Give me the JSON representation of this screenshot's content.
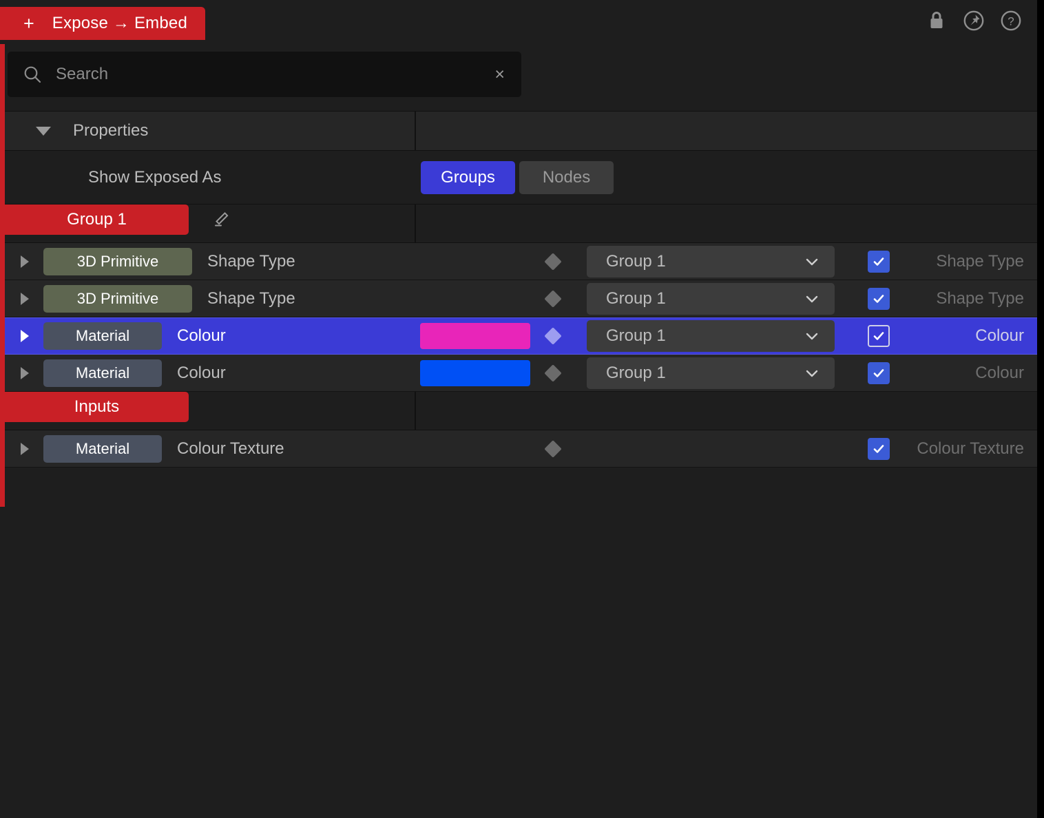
{
  "topbar": {
    "expose_tab": {
      "plus": "+",
      "label": "Expose → Embed"
    },
    "icons": [
      {
        "name": "lock-icon",
        "title": "Lock"
      },
      {
        "name": "pin-icon",
        "title": "Pin"
      },
      {
        "name": "help-icon",
        "title": "Help"
      }
    ]
  },
  "search": {
    "placeholder": "Search",
    "value": "",
    "clear_label": "×"
  },
  "sections": {
    "properties": {
      "title": "Properties",
      "expanded": true,
      "show_exposed_as": {
        "label": "Show Exposed As",
        "options": [
          "Groups",
          "Nodes"
        ],
        "selected": "Groups"
      }
    },
    "group1": {
      "tab_label": "Group 1",
      "edit_icon": "pencil-icon"
    },
    "inputs": {
      "tab_label": "Inputs"
    }
  },
  "colors": {
    "accent_red": "#c92026",
    "accent_blue": "#3b3bd6",
    "chip_primitive": "#5e6650",
    "chip_material": "#4a5160",
    "swatch_magenta": "#e825b9",
    "swatch_blue": "#0050f5",
    "checkbox_blue": "#3b5bd6",
    "panel_bg": "#1e1e1e",
    "row_bg": "#262626"
  },
  "group_rows": [
    {
      "node_type": "3D Primitive",
      "chip_style": "primitive",
      "property": "Shape Type",
      "swatch": null,
      "keyframe": true,
      "group": "Group 1",
      "checked": true,
      "exposed_name": "Shape Type",
      "selected": false
    },
    {
      "node_type": "3D Primitive",
      "chip_style": "primitive",
      "property": "Shape Type",
      "swatch": null,
      "keyframe": true,
      "group": "Group 1",
      "checked": true,
      "exposed_name": "Shape Type",
      "selected": false
    },
    {
      "node_type": "Material",
      "chip_style": "material",
      "property": "Colour",
      "swatch": "#e825b9",
      "keyframe": true,
      "group": "Group 1",
      "checked": true,
      "exposed_name": "Colour",
      "selected": true
    },
    {
      "node_type": "Material",
      "chip_style": "material",
      "property": "Colour",
      "swatch": "#0050f5",
      "keyframe": true,
      "group": "Group 1",
      "checked": true,
      "exposed_name": "Colour",
      "selected": false
    }
  ],
  "input_rows": [
    {
      "node_type": "Material",
      "chip_style": "material",
      "property": "Colour Texture",
      "swatch": null,
      "keyframe": true,
      "group": null,
      "checked": true,
      "exposed_name": "Colour Texture",
      "selected": false
    }
  ]
}
